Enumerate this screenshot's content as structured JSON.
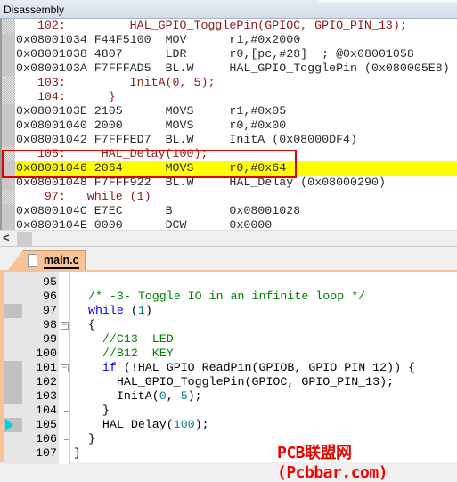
{
  "disassembly": {
    "title": "Disassembly",
    "lines": [
      {
        "type": "src",
        "text": "   102:         HAL_GPIO_TogglePin(GPIOC, GPIO_PIN_13);"
      },
      {
        "type": "asm",
        "text": "0x08001034 F44F5100  MOV      r1,#0x2000"
      },
      {
        "type": "asm",
        "text": "0x08001038 4807      LDR      r0,[pc,#28]  ; @0x08001058"
      },
      {
        "type": "asm",
        "text": "0x0800103A F7FFFAD5  BL.W     HAL_GPIO_TogglePin (0x080005E8)"
      },
      {
        "type": "src",
        "text": "   103:         InitA(0, 5);"
      },
      {
        "type": "src",
        "text": "   104:      }"
      },
      {
        "type": "asm",
        "text": "0x0800103E 2105      MOVS     r1,#0x05"
      },
      {
        "type": "asm",
        "text": "0x08001040 2000      MOVS     r0,#0x00"
      },
      {
        "type": "asm",
        "text": "0x08001042 F7FFFED7  BL.W     InitA (0x08000DF4)"
      },
      {
        "type": "src",
        "text": "   105:     HAL_Delay(100);"
      },
      {
        "type": "asm",
        "text": "0x08001046 2064      MOVS     r0,#0x64",
        "current": true
      },
      {
        "type": "asm",
        "text": "0x08001048 F7FFF922  BL.W     HAL_Delay (0x08000290)"
      },
      {
        "type": "src",
        "text": "    97:   while (1)"
      },
      {
        "type": "asm",
        "text": "0x0800104C E7EC      B        0x08001028"
      },
      {
        "type": "asm",
        "text": "0x0800104E 0000      DCW      0x0000"
      }
    ]
  },
  "scrollbar": {
    "left_arrow_icon": "chevron-left-icon"
  },
  "editor": {
    "tab_label": "main.c",
    "tab_icon": "file-icon",
    "lines": [
      {
        "num": "95",
        "mark": false,
        "fold": "",
        "segs": []
      },
      {
        "num": "96",
        "mark": false,
        "fold": "",
        "segs": [
          {
            "c": "comment",
            "t": "  /* -3- Toggle IO in an infinite loop */"
          }
        ]
      },
      {
        "num": "97",
        "mark": true,
        "fold": "",
        "segs": [
          {
            "c": "keyword",
            "t": "  while"
          },
          {
            "c": "default",
            "t": " ("
          },
          {
            "c": "number",
            "t": "1"
          },
          {
            "c": "default",
            "t": ")"
          }
        ]
      },
      {
        "num": "98",
        "mark": false,
        "fold": "box",
        "segs": [
          {
            "c": "default",
            "t": "  {"
          }
        ]
      },
      {
        "num": "99",
        "mark": false,
        "fold": "",
        "segs": [
          {
            "c": "comment",
            "t": "    //C13  LED"
          }
        ]
      },
      {
        "num": "100",
        "mark": false,
        "fold": "",
        "segs": [
          {
            "c": "comment",
            "t": "    //B12  KEY"
          }
        ]
      },
      {
        "num": "101",
        "mark": true,
        "fold": "box",
        "segs": [
          {
            "c": "keyword",
            "t": "    if"
          },
          {
            "c": "default",
            "t": " (!HAL_GPIO_ReadPin(GPIOB, GPIO_PIN_12)) {"
          }
        ]
      },
      {
        "num": "102",
        "mark": true,
        "fold": "",
        "segs": [
          {
            "c": "default",
            "t": "      HAL_GPIO_TogglePin(GPIOC, GPIO_PIN_13);"
          }
        ]
      },
      {
        "num": "103",
        "mark": true,
        "fold": "",
        "segs": [
          {
            "c": "default",
            "t": "      InitA("
          },
          {
            "c": "number",
            "t": "0"
          },
          {
            "c": "default",
            "t": ", "
          },
          {
            "c": "number",
            "t": "5"
          },
          {
            "c": "default",
            "t": ");"
          }
        ]
      },
      {
        "num": "104",
        "mark": false,
        "fold": "end",
        "segs": [
          {
            "c": "default",
            "t": "    }"
          }
        ]
      },
      {
        "num": "105",
        "mark": true,
        "current": true,
        "fold": "",
        "segs": [
          {
            "c": "default",
            "t": "    HAL_Delay("
          },
          {
            "c": "number",
            "t": "100"
          },
          {
            "c": "default",
            "t": ");"
          }
        ]
      },
      {
        "num": "106",
        "mark": false,
        "fold": "end",
        "segs": [
          {
            "c": "default",
            "t": "  }"
          }
        ]
      },
      {
        "num": "107",
        "mark": false,
        "fold": "",
        "segs": [
          {
            "c": "default",
            "t": "}"
          }
        ]
      }
    ]
  },
  "watermark": "PCB联盟网 (Pcbbar.com)",
  "colors": {
    "highlight": "#ffff00",
    "box": "#e00000",
    "tab": "#f7c396",
    "current_arrow": "#00d0e0"
  }
}
